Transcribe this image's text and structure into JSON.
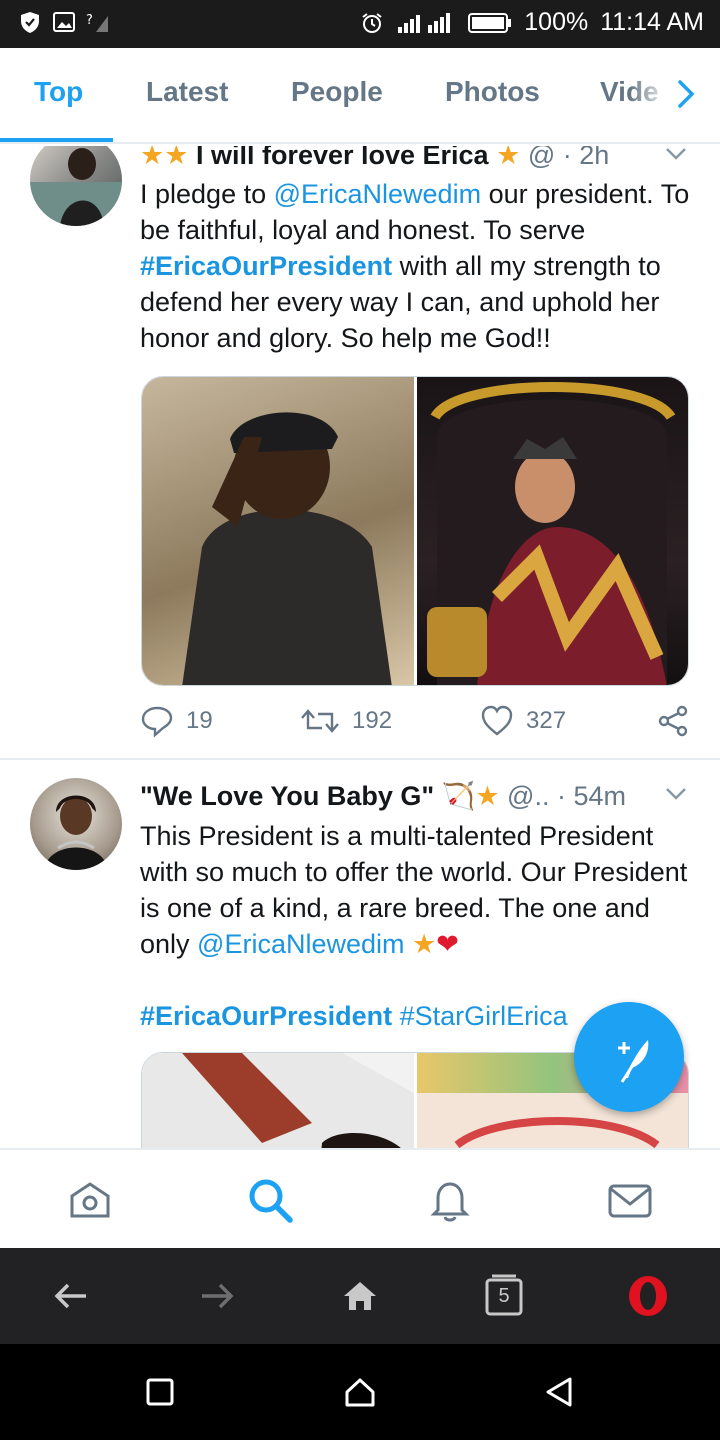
{
  "status_bar": {
    "battery": "100%",
    "time": "11:14 AM"
  },
  "tabs": [
    {
      "label": "Top",
      "active": true
    },
    {
      "label": "Latest",
      "active": false
    },
    {
      "label": "People",
      "active": false
    },
    {
      "label": "Photos",
      "active": false
    },
    {
      "label": "Vide",
      "active": false
    }
  ],
  "tweets": [
    {
      "name": "I will forever love Erica",
      "handle": "@",
      "time": "· 2h",
      "text_parts": {
        "p1": "I pledge to ",
        "mention": "@EricaNlewedim",
        "p2": " our president. To be faithful, loyal and honest. To serve ",
        "hashtag": "#EricaOurPresident",
        "p3": "  with all my strength to defend her every way I can, and uphold her honor and glory. So help me God!!"
      },
      "replies": "19",
      "retweets": "192",
      "likes": "327"
    },
    {
      "name": "\"We Love You Baby G\"",
      "handle": "@..",
      "time": "· 54m",
      "text_parts": {
        "p1": "This President is a multi-talented President with so much to offer the world. Our President is one of a kind, a rare breed. The one and only ",
        "mention": "@EricaNlewedim",
        "hashtag1": "#EricaOurPresident",
        "hashtag2": "#StarGirlErica"
      }
    }
  ],
  "browser_bar": {
    "tab_count": "5"
  },
  "colors": {
    "accent": "#1da1f2",
    "link": "#1b95e0",
    "muted": "#657786"
  }
}
